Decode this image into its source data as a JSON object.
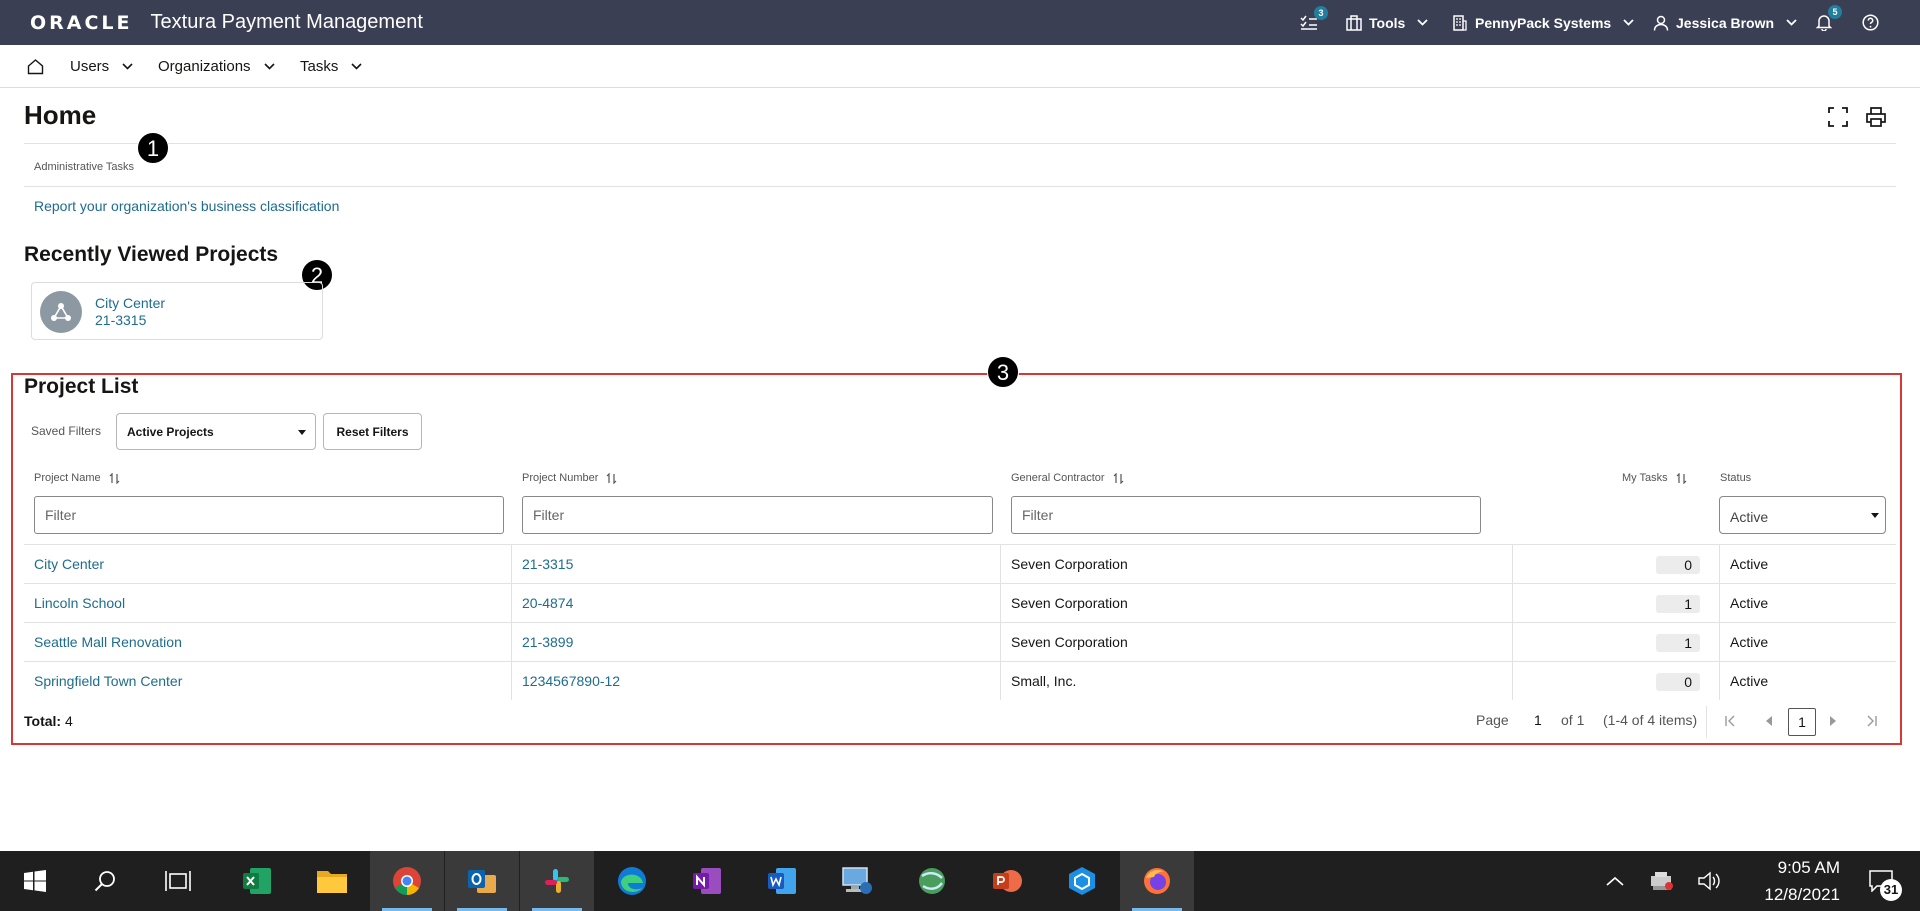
{
  "topbar": {
    "brand": "ORACLE",
    "app_name": "Textura Payment Management",
    "tasks_badge": "3",
    "tools_label": "Tools",
    "org_label": "PennyPack Systems",
    "user_label": "Jessica Brown",
    "notifications_badge": "5"
  },
  "nav": {
    "users": "Users",
    "organizations": "Organizations",
    "tasks": "Tasks"
  },
  "page": {
    "title": "Home"
  },
  "admin": {
    "heading": "Administrative Tasks",
    "link": "Report your organization's business classification"
  },
  "recent": {
    "title": "Recently Viewed Projects",
    "card_name": "City Center",
    "card_number": "21-3315"
  },
  "callouts": [
    "1",
    "2",
    "3"
  ],
  "project_list": {
    "title": "Project List",
    "saved_filters_label": "Saved Filters",
    "saved_filter_value": "Active Projects",
    "reset_button": "Reset Filters",
    "columns": {
      "name": "Project Name",
      "number": "Project Number",
      "contractor": "General Contractor",
      "tasks": "My Tasks",
      "status": "Status"
    },
    "filter_placeholder": "Filter",
    "status_filter_value": "Active",
    "rows": [
      {
        "name": "City Center",
        "number": "21-3315",
        "contractor": "Seven Corporation",
        "tasks": "0",
        "status": "Active"
      },
      {
        "name": "Lincoln School",
        "number": "20-4874",
        "contractor": "Seven Corporation",
        "tasks": "1",
        "status": "Active"
      },
      {
        "name": "Seattle Mall Renovation",
        "number": "21-3899",
        "contractor": "Seven Corporation",
        "tasks": "1",
        "status": "Active"
      },
      {
        "name": "Springfield Town Center",
        "number": "1234567890-12",
        "contractor": "Small, Inc.",
        "tasks": "0",
        "status": "Active"
      }
    ],
    "total_label": "Total:",
    "total_value": "4",
    "page_label": "Page",
    "page_input": "1",
    "page_of": "of 1",
    "items_range": "(1-4 of 4 items)",
    "current_page": "1"
  },
  "taskbar": {
    "time": "9:05 AM",
    "date": "12/8/2021",
    "notification_count": "31"
  },
  "colors": {
    "header_bg": "#3a3f53",
    "link": "#1e6c8e",
    "highlight_box": "#d93636",
    "badge": "#227e9e",
    "taskbar": "#1f1f1f"
  }
}
